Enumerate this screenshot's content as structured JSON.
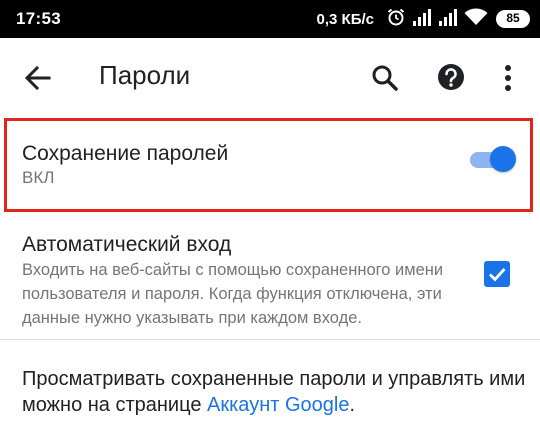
{
  "status_bar": {
    "time": "17:53",
    "network_speed": "0,3 КБ/с",
    "battery_level": "85",
    "icons": [
      "alarm-icon",
      "signal-icon",
      "signal-icon",
      "wifi-icon",
      "battery-icon"
    ]
  },
  "toolbar": {
    "title": "Пароли",
    "icons": [
      "arrow-back-icon",
      "search-icon",
      "help-icon",
      "more-vert-icon"
    ]
  },
  "save_passwords": {
    "title": "Сохранение паролей",
    "state_label": "ВКЛ",
    "enabled": true
  },
  "auto_signin": {
    "title": "Автоматический вход",
    "description": "Входить на веб-сайты с помощью сохраненного имени пользователя и пароля. Когда функция отключена, эти данные нужно указывать при каждом входе.",
    "checked": true
  },
  "manage": {
    "text_before": "Просматривать сохраненные пароли и управлять ими можно на странице ",
    "link_text": "Аккаунт Google",
    "text_after": "."
  },
  "colors": {
    "accent": "#1a73e8",
    "highlight": "#e1251b",
    "text_primary": "#202124",
    "text_secondary": "#757575",
    "status_bar": "#000000"
  }
}
